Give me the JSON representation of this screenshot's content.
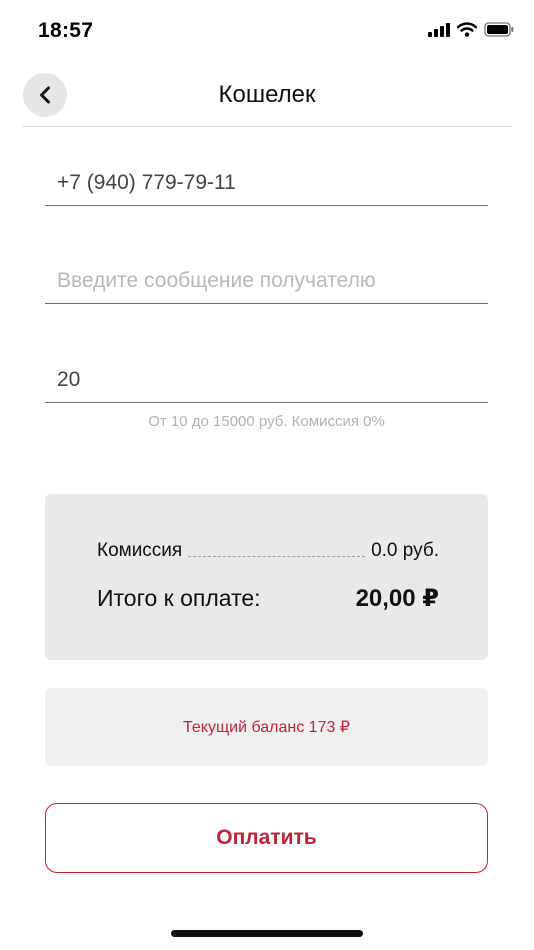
{
  "status_bar": {
    "time": "18:57",
    "icons": [
      "signal-icon",
      "wifi-icon",
      "battery-icon"
    ]
  },
  "header": {
    "back_icon": "chevron-left-icon",
    "title": "Кошелек"
  },
  "form": {
    "phone": {
      "value": "+7 (940) 779-79-11",
      "placeholder": ""
    },
    "message": {
      "value": "",
      "placeholder": "Введите сообщение получателю"
    },
    "amount": {
      "value": "20",
      "placeholder": ""
    },
    "hint": "От 10 до 15000 руб. Комиссия 0%"
  },
  "summary": {
    "commission_label": "Комиссия",
    "commission_value": "0.0 руб.",
    "total_label": "Итого к оплате:",
    "total_value": "20,00 ₽"
  },
  "balance": {
    "text": "Текущий баланс 173 ₽"
  },
  "pay_button": {
    "label": "Оплатить"
  },
  "colors": {
    "accent": "#c0243c",
    "card_bg": "#e9e9e9",
    "balance_bg": "#f0f0f0"
  }
}
